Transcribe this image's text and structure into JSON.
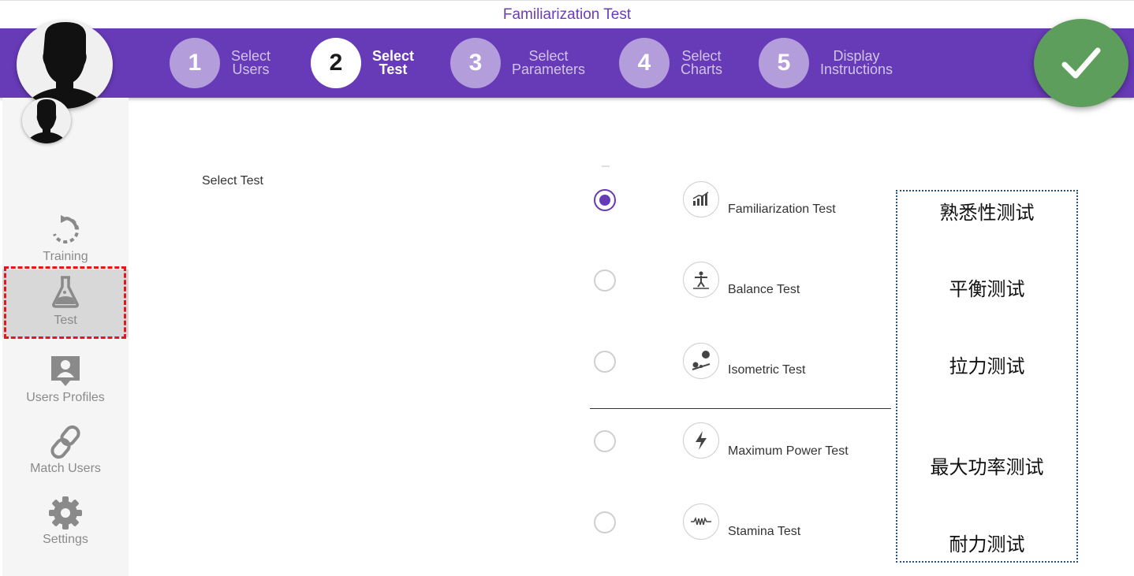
{
  "window": {
    "title": "Familiarization Test"
  },
  "stepper": {
    "steps": [
      {
        "number": "1",
        "line1": "Select",
        "line2": "Users"
      },
      {
        "number": "2",
        "line1": "Select",
        "line2": "Test"
      },
      {
        "number": "3",
        "line1": "Select",
        "line2": "Parameters"
      },
      {
        "number": "4",
        "line1": "Select",
        "line2": "Charts"
      },
      {
        "number": "5",
        "line1": "Display",
        "line2": "Instructions"
      }
    ],
    "active_step": 2
  },
  "sidebar": {
    "items": [
      {
        "label": "Training",
        "icon": "refresh-icon"
      },
      {
        "label": "Test",
        "icon": "flask-icon"
      },
      {
        "label": "Users Profiles",
        "icon": "user-profile-icon"
      },
      {
        "label": "Match Users",
        "icon": "link-icon"
      },
      {
        "label": "Settings",
        "icon": "gear-icon"
      }
    ],
    "active": "Test"
  },
  "main": {
    "section_label": "Select Test",
    "options": [
      {
        "label": "Familiarization Test",
        "icon": "bar-chart-icon",
        "selected": true
      },
      {
        "label": "Balance Test",
        "icon": "balance-icon",
        "selected": false
      },
      {
        "label": "Isometric Test",
        "icon": "isometric-icon",
        "selected": false
      },
      {
        "label": "Maximum Power Test",
        "icon": "lightning-icon",
        "selected": false
      },
      {
        "label": "Stamina Test",
        "icon": "wave-icon",
        "selected": false
      }
    ]
  },
  "annotations": [
    "熟悉性测试",
    "平衡测试",
    "拉力测试",
    "最大功率测试",
    "耐力测试"
  ],
  "colors": {
    "brand": "#673ab7",
    "accent_check": "#5e9e5c",
    "highlight": "#e8141e",
    "annotation_border": "#2b4f8a"
  }
}
